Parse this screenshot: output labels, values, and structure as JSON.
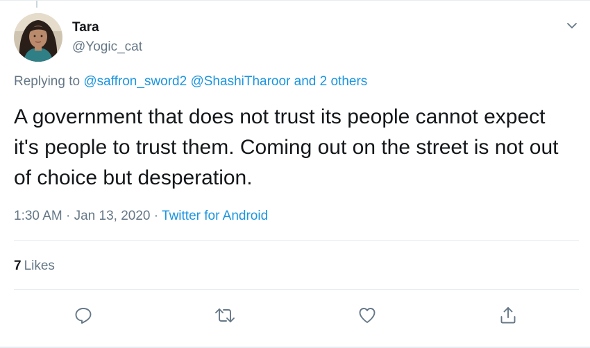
{
  "user": {
    "name": "Tara",
    "handle": "@Yogic_cat"
  },
  "reply": {
    "prefix": "Replying to",
    "mentions": "@saffron_sword2 @ShashiTharoor and 2 others"
  },
  "tweet": {
    "text": "A government that does not trust its people cannot expect it's people to trust them. Coming out on the street is not out of choice but desperation."
  },
  "meta": {
    "time": "1:30 AM",
    "separator": "·",
    "date": "Jan 13, 2020",
    "source": "Twitter for Android"
  },
  "stats": {
    "likes_count": "7",
    "likes_label": "Likes"
  },
  "actions": [
    {
      "icon": "reply-icon"
    },
    {
      "icon": "retweet-icon"
    },
    {
      "icon": "like-icon"
    },
    {
      "icon": "share-icon"
    }
  ],
  "colors": {
    "text": "#14171a",
    "secondary": "#657786",
    "link": "#1b95e0",
    "divider": "#e6ecf0"
  }
}
